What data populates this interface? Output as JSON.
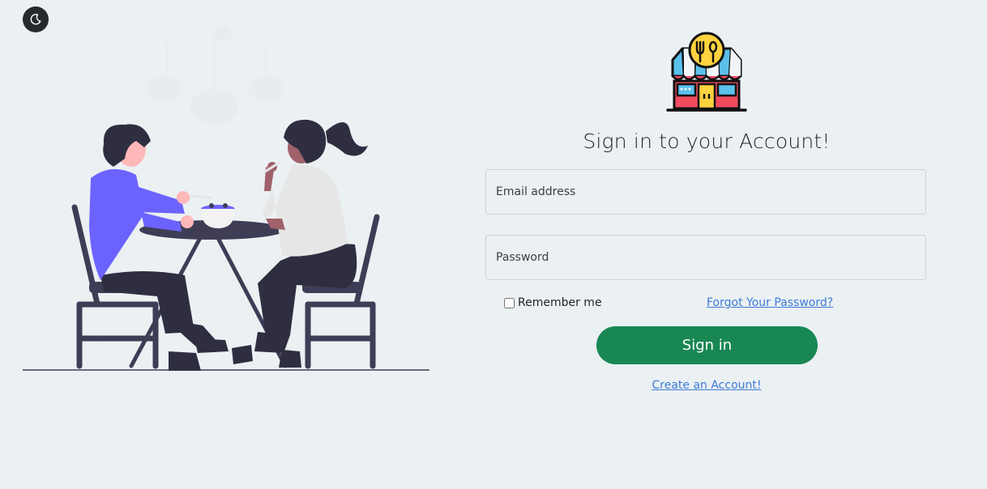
{
  "header": {
    "theme_toggle_icon": "moon-icon"
  },
  "illustration": {
    "name": "people-dining-illustration"
  },
  "logo": {
    "icon": "restaurant-store-icon"
  },
  "form": {
    "title": "Sign in to your Account!",
    "email_placeholder": "Email address",
    "password_placeholder": "Password",
    "remember_label": "Remember me",
    "forgot_link": "Forgot Your Password?",
    "signin_label": "Sign in",
    "create_link": "Create an Account!"
  },
  "colors": {
    "background": "#ebf0f3",
    "primary_button": "#198754",
    "link": "#3d7bd6"
  }
}
